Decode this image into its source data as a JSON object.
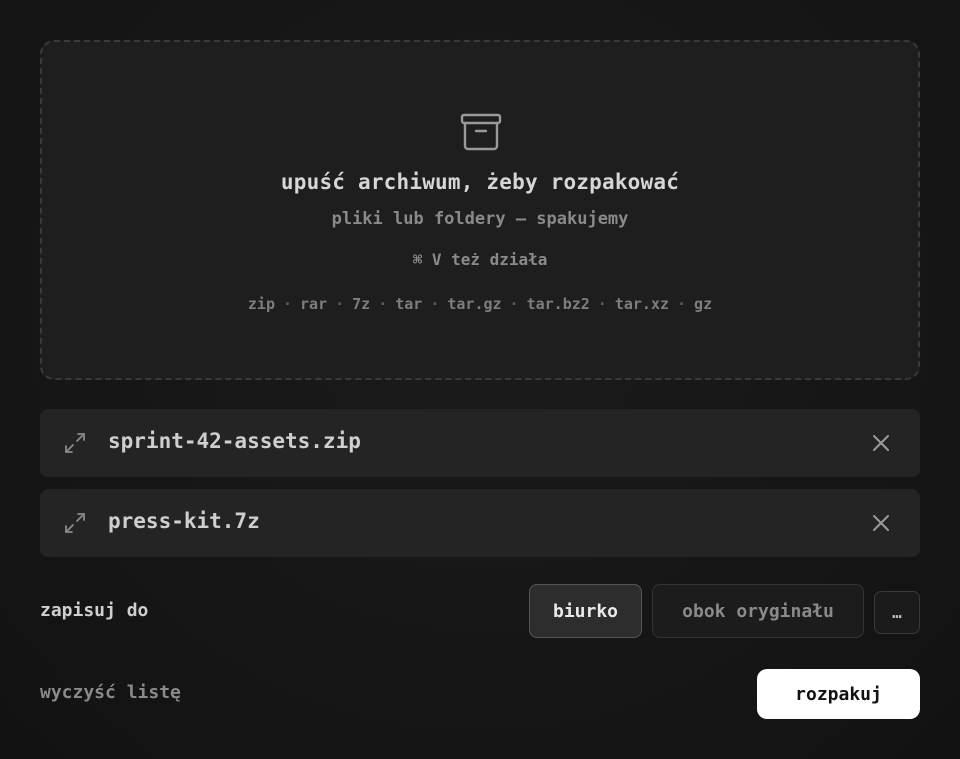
{
  "dropzone": {
    "icon": "archive-box-icon",
    "title": "upuść archiwum, żeby rozpakować",
    "subtitle": "pliki lub foldery — spakujemy",
    "paste_hint": "⌘ V też działa",
    "formats": [
      "zip",
      "rar",
      "7z",
      "tar",
      "tar.gz",
      "tar.bz2",
      "tar.xz",
      "gz"
    ],
    "separator": "·"
  },
  "files": [
    {
      "name": "sprint-42-assets.zip",
      "icon": "expand-arrows-icon"
    },
    {
      "name": "press-kit.7z",
      "icon": "expand-arrows-icon"
    }
  ],
  "save": {
    "label": "zapisuj do",
    "options": [
      {
        "label": "biurko",
        "selected": true
      },
      {
        "label": "obok oryginału",
        "selected": false
      }
    ],
    "more_label": "…"
  },
  "actions": {
    "clear_label": "wyczyść listę",
    "extract_label": "rozpakuj"
  },
  "colors": {
    "background": "#161616",
    "panel": "#242424",
    "primary_button": "#ffffff"
  }
}
